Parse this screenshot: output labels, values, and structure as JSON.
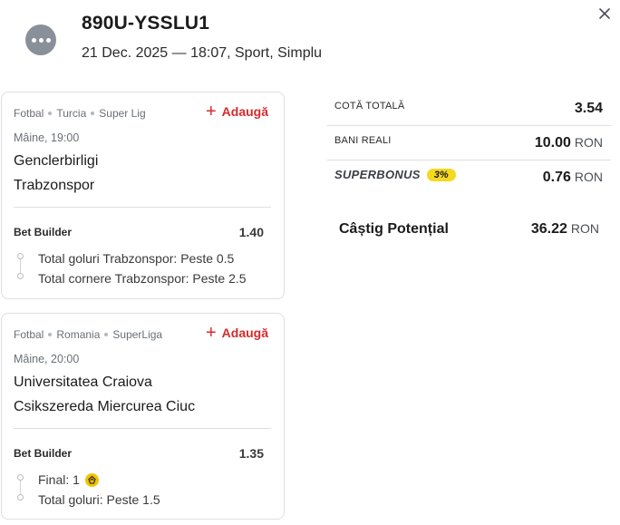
{
  "header": {
    "ticket_id": "890U-YSSLU1",
    "meta": "21 Dec. 2025 — 18:07, Sport, Simplu"
  },
  "bets": [
    {
      "sport": "Fotbal",
      "country": "Turcia",
      "league": "Super Lig",
      "add_label": "Adaugă",
      "kickoff": "Mâine, 19:00",
      "home": "Genclerbirligi",
      "away": "Trabzonspor",
      "builder_label": "Bet Builder",
      "odds": "1.40",
      "legs": [
        "Total goluri Trabzonspor: Peste 0.5",
        "Total cornere Trabzonspor: Peste 2.5"
      ]
    },
    {
      "sport": "Fotbal",
      "country": "Romania",
      "league": "SuperLiga",
      "add_label": "Adaugă",
      "kickoff": "Mâine, 20:00",
      "home": "Universitatea Craiova",
      "away": "Csikszereda Miercurea Ciuc",
      "builder_label": "Bet Builder",
      "odds": "1.35",
      "legs": [
        "Final: 1",
        "Total goluri: Peste 1.5"
      ]
    }
  ],
  "summary": {
    "total_odds_label": "COTĂ TOTALĂ",
    "total_odds": "3.54",
    "stake_label": "BANI REALI",
    "stake": "10.00",
    "currency": "RON",
    "superbonus_label": "SUPERBONUS",
    "superbonus_pct": "3%",
    "superbonus_value": "0.76",
    "win_label": "Câștig Potențial",
    "win_value": "36.22"
  },
  "colors": {
    "accent_red": "#d62b2b",
    "superbonus_yellow": "#f6d91f",
    "avatar_grey": "#8a9099"
  },
  "icons": {
    "avatar": "more-dots-icon",
    "close": "close-icon",
    "add": "plus-icon",
    "leg_badge": "boost-badge-icon"
  }
}
